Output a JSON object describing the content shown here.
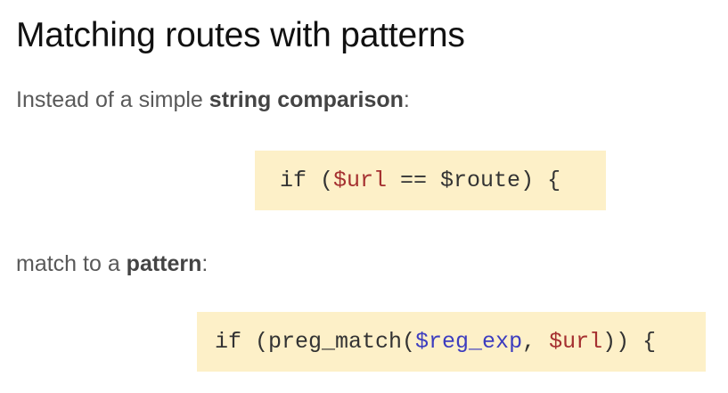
{
  "title": "Matching routes with patterns",
  "intro": {
    "prefix": "Instead of a simple ",
    "emphasis": "string comparison",
    "suffix": ":"
  },
  "code1": {
    "t1": "if (",
    "v1": "$url",
    "t2": " == ",
    "t3": "$route",
    "t4": ") {"
  },
  "pattern": {
    "prefix": "match to a ",
    "emphasis": "pattern",
    "suffix": ":"
  },
  "code2": {
    "t1": "if (preg_match(",
    "v1": "$reg_exp",
    "t2": ", ",
    "v2": "$url",
    "t3": ")) {"
  },
  "colors": {
    "code_background": "#fdf0c8",
    "variable_red": "#a53030",
    "variable_blue": "#3d3dbf"
  }
}
